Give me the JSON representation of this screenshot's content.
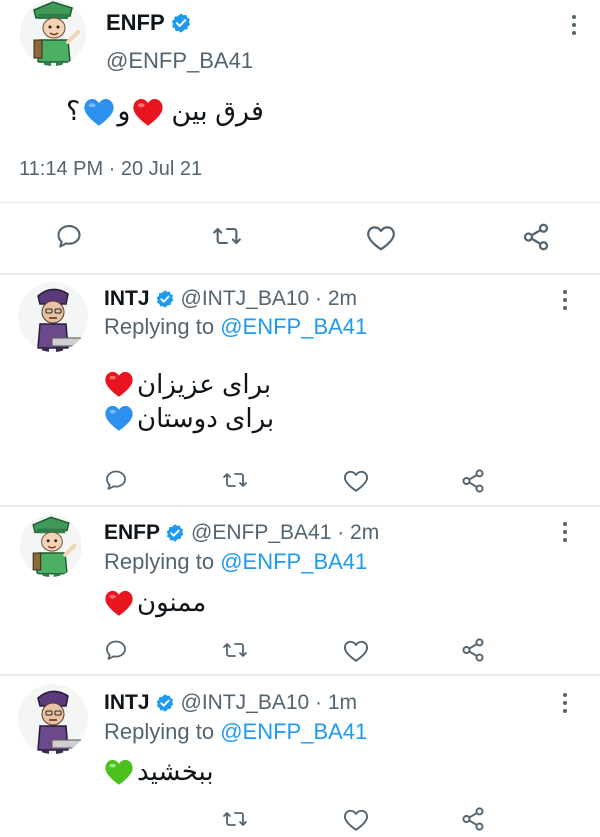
{
  "colors": {
    "link": "#1d9bf0",
    "verified": "#1d9bf0",
    "secondary_text": "#536471",
    "heart_red": "#e8141f",
    "heart_blue": "#2d8ff0",
    "heart_green": "#4bc11e"
  },
  "icons": {
    "verified": "verified-badge-icon",
    "reply": "comment-icon",
    "retweet": "retweet-icon",
    "like": "heart-icon",
    "share": "share-icon",
    "more": "more-vertical-icon"
  },
  "main_tweet": {
    "name": "ENFP",
    "handle": "@ENFP_BA41",
    "text": "فرق بین",
    "text_connector": "و",
    "text_end": "؟",
    "timestamp": "11:14 PM · 20 Jul 21"
  },
  "replies": [
    {
      "name": "INTJ",
      "handle_time": "@INTJ_BA10 · 2m",
      "replying_prefix": "Replying to",
      "replying_handle": "@ENFP_BA41",
      "lines": [
        "برای عزیزان",
        "برای دوستان"
      ]
    },
    {
      "name": "ENFP",
      "handle_time": "@ENFP_BA41 · 2m",
      "replying_prefix": "Replying to",
      "replying_handle": "@ENFP_BA41",
      "lines": [
        "ممنون"
      ]
    },
    {
      "name": "INTJ",
      "handle_time": "@INTJ_BA10 · 1m",
      "replying_prefix": "Replying to",
      "replying_handle": "@ENFP_BA41",
      "lines": [
        "ببخشید"
      ]
    }
  ]
}
